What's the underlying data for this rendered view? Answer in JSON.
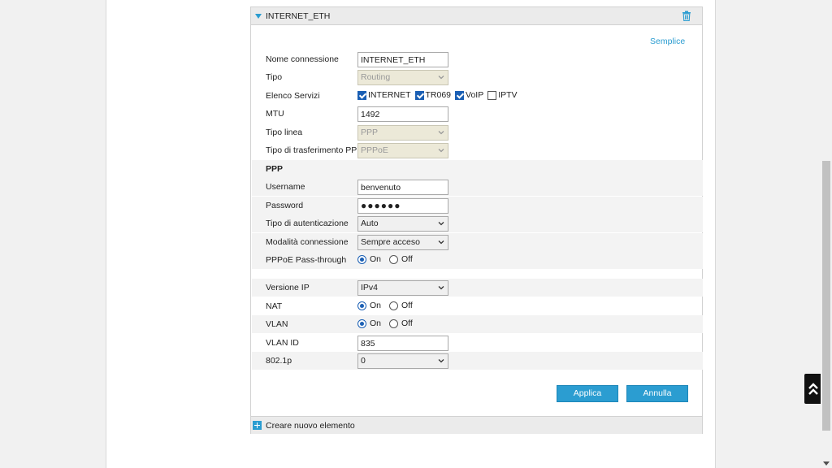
{
  "section": {
    "title": "INTERNET_ETH",
    "mode_link": "Semplice"
  },
  "fields": {
    "nome_connessione": {
      "label": "Nome connessione",
      "value": "INTERNET_ETH"
    },
    "tipo": {
      "label": "Tipo",
      "value": "Routing"
    },
    "elenco_servizi": {
      "label": "Elenco Servizi",
      "options": [
        {
          "label": "INTERNET",
          "checked": true
        },
        {
          "label": "TR069",
          "checked": true
        },
        {
          "label": "VoIP",
          "checked": true
        },
        {
          "label": "IPTV",
          "checked": false
        }
      ]
    },
    "mtu": {
      "label": "MTU",
      "value": "1492"
    },
    "tipo_linea": {
      "label": "Tipo linea",
      "value": "PPP"
    },
    "tipo_trasferimento": {
      "label": "Tipo di trasferimento PPP",
      "value": "PPPoE"
    }
  },
  "ppp": {
    "title": "PPP",
    "username": {
      "label": "Username",
      "value": "benvenuto"
    },
    "password": {
      "label": "Password",
      "value": "●●●●●●"
    },
    "tipo_autenticazione": {
      "label": "Tipo di autenticazione",
      "value": "Auto"
    },
    "modalita_connessione": {
      "label": "Modalità connessione",
      "value": "Sempre acceso"
    },
    "pppoe_passthrough": {
      "label": "PPPoE Pass-through",
      "on": "On",
      "off": "Off",
      "selected": "On"
    }
  },
  "network": {
    "versione_ip": {
      "label": "Versione IP",
      "value": "IPv4"
    },
    "nat": {
      "label": "NAT",
      "on": "On",
      "off": "Off",
      "selected": "On"
    },
    "vlan": {
      "label": "VLAN",
      "on": "On",
      "off": "Off",
      "selected": "On"
    },
    "vlan_id": {
      "label": "VLAN ID",
      "value": "835"
    },
    "dot1p": {
      "label": "802.1p",
      "value": "0"
    }
  },
  "buttons": {
    "apply": "Applica",
    "cancel": "Annulla"
  },
  "footer": {
    "add_label": "Creare nuovo elemento"
  },
  "colors": {
    "accent": "#2b9dd1",
    "checkbox": "#1a5fb4"
  }
}
